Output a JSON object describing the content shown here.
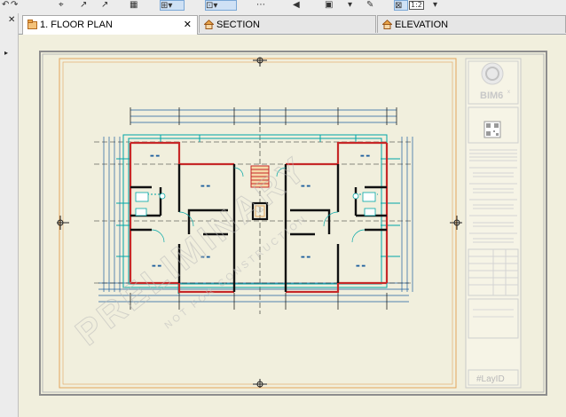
{
  "toolbar": {
    "icons": [
      "undo-icon",
      "redo-icon",
      "pick-icon",
      "arrow-tool-icon",
      "arrow-tool-2-icon",
      "select-tool-icon",
      "marquee-tool-icon",
      "dimension-tool-icon",
      "zoom-icon",
      "zoom-2-icon",
      "view-icon",
      "layers-icon",
      "home-icon",
      "layout-icon"
    ],
    "zoom_label": "1:2"
  },
  "left_panel": {
    "close_label": "✕",
    "expand_label": "▸"
  },
  "tabs": [
    {
      "label": "1. FLOOR PLAN",
      "close_label": "✕",
      "icon": "floor-plan-icon"
    },
    {
      "label": "SECTION",
      "icon": "house-icon"
    },
    {
      "label": "ELEVATION",
      "icon": "house-icon"
    }
  ],
  "sheet": {
    "logo_text": "BIM6",
    "logo_superscript": "x",
    "watermark_main": "PRELIMINARY",
    "watermark_sub": "NOT FOR CONSTRUCTION",
    "layout_id": "#LayID",
    "colors": {
      "background": "#f1efdd",
      "wall": "#111111",
      "exterior_wall": "#c62828",
      "grid_line": "#00a6a6",
      "dimension_line": "#1d5f9e",
      "title_block_border": "#e3a45c"
    }
  }
}
